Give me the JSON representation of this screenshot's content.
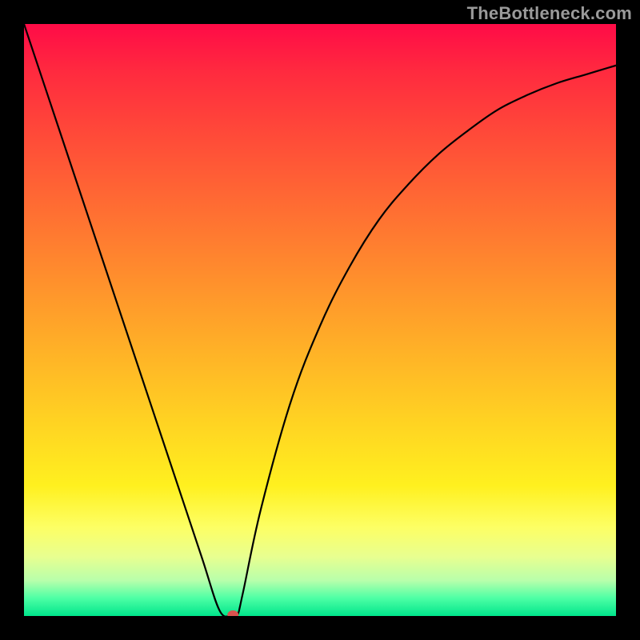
{
  "watermark": {
    "text": "TheBottleneck.com"
  },
  "chart_data": {
    "type": "line",
    "title": "",
    "xlabel": "",
    "ylabel": "",
    "xlim": [
      0,
      100
    ],
    "ylim": [
      0,
      100
    ],
    "grid": false,
    "series": [
      {
        "name": "bottleneck-curve",
        "x": [
          0,
          5,
          10,
          15,
          20,
          25,
          30,
          33,
          35,
          36,
          37,
          40,
          45,
          50,
          55,
          60,
          65,
          70,
          75,
          80,
          85,
          90,
          95,
          100
        ],
        "y": [
          100,
          85,
          70,
          55,
          40,
          25,
          10,
          1,
          0,
          0,
          4,
          18,
          36,
          49,
          59,
          67,
          73,
          78,
          82,
          85.5,
          88,
          90,
          91.5,
          93
        ]
      }
    ],
    "marker": {
      "x": 35.3,
      "y": 0.2,
      "color": "#d9534f"
    },
    "background": {
      "type": "vertical-gradient",
      "stops": [
        {
          "pos": 0,
          "color": "#ff0b47"
        },
        {
          "pos": 50,
          "color": "#ffb127"
        },
        {
          "pos": 80,
          "color": "#fdff64"
        },
        {
          "pos": 100,
          "color": "#00e58b"
        }
      ]
    }
  }
}
